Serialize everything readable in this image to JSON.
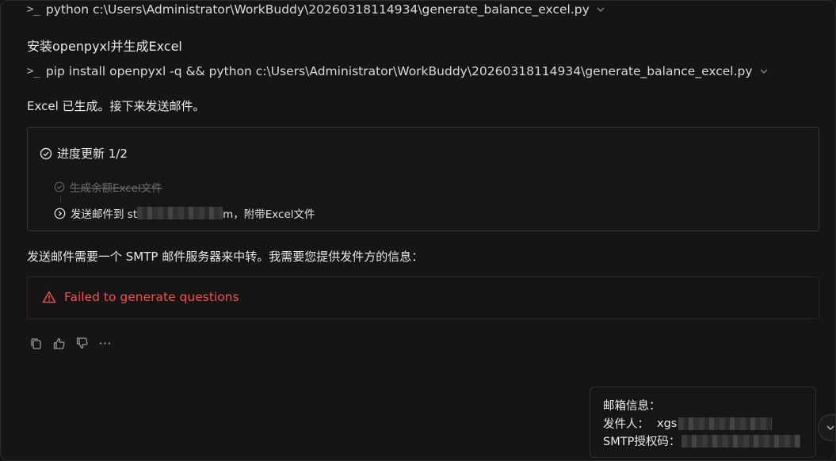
{
  "commands": [
    {
      "prompt": ">_",
      "text": "python c:\\Users\\Administrator\\WorkBuddy\\20260318114934\\generate_balance_excel.py"
    },
    {
      "prompt": ">_",
      "text": "pip install openpyxl -q && python c:\\Users\\Administrator\\WorkBuddy\\20260318114934\\generate_balance_excel.py"
    }
  ],
  "messages": {
    "install_heading": "安装openpyxl并生成Excel",
    "excel_done": "Excel 已生成。接下来发送邮件。",
    "smtp_note": "发送邮件需要一个 SMTP 邮件服务器来中转。我需要您提供发件方的信息："
  },
  "progress": {
    "title": "进度更新 1/2",
    "tasks": [
      {
        "label": "生成余额Excel文件",
        "status": "done"
      },
      {
        "label_prefix": "发送邮件到 st",
        "label_suffix": "m，附带Excel文件",
        "status": "current"
      }
    ]
  },
  "error": {
    "text": "Failed to generate questions"
  },
  "actions": [
    {
      "icon": "copy-icon"
    },
    {
      "icon": "thumbs-up-icon"
    },
    {
      "icon": "thumbs-down-icon"
    },
    {
      "icon": "more-icon"
    }
  ],
  "mail_info": {
    "title": "邮箱信息：",
    "sender_label": "发件人：",
    "sender_value": "xgs",
    "smtp_label": "SMTP授权码："
  },
  "colors": {
    "background": "#151515",
    "error": "#f0504f",
    "text": "#e6e6e6",
    "muted": "#6d6d6d"
  }
}
